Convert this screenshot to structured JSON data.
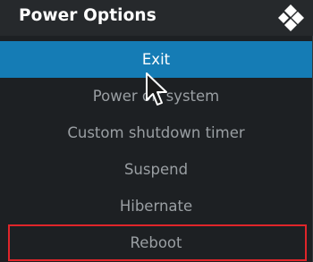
{
  "dialog": {
    "title": "Power Options",
    "logo_icon": "kodi-logo-icon"
  },
  "menu": {
    "items": [
      {
        "label": "Exit",
        "state": "focused"
      },
      {
        "label": "Power off system",
        "state": "normal"
      },
      {
        "label": "Custom shutdown timer",
        "state": "normal"
      },
      {
        "label": "Suspend",
        "state": "normal"
      },
      {
        "label": "Hibernate",
        "state": "normal"
      },
      {
        "label": "Reboot",
        "state": "highlighted-outline"
      }
    ]
  },
  "colors": {
    "background": "#1d2023",
    "header": "#26292c",
    "focus": "#157cb5",
    "text": "#9a9fa3",
    "outline": "#e0252a"
  }
}
